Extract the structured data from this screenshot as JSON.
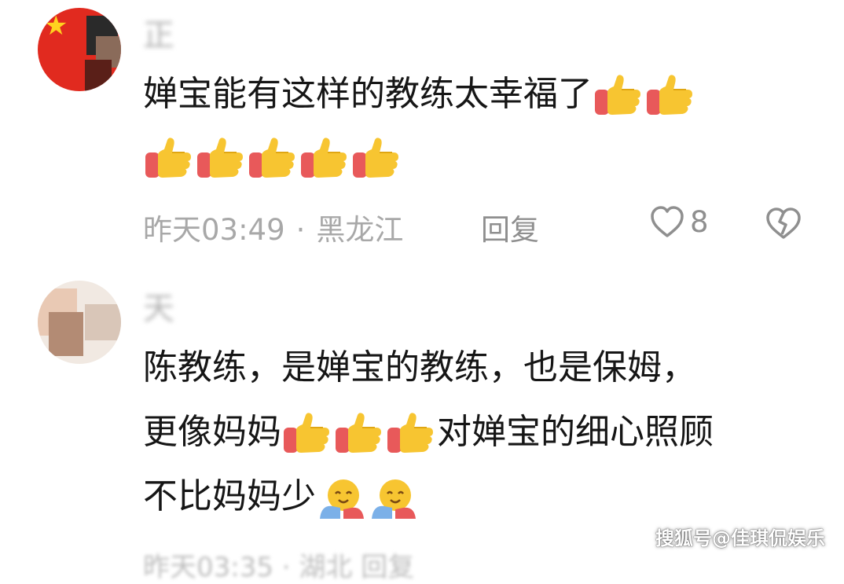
{
  "comments": [
    {
      "username": "正",
      "lines": [
        "婵宝能有这样的教练太幸福了",
        ""
      ],
      "time": "昨天03:49",
      "location": "黑龙江",
      "reply": "回复",
      "likes": "8"
    },
    {
      "username": "天",
      "lines": [
        "陈教练，是婵宝的教练，也是保姆，",
        "更像妈妈",
        "对婵宝的细心照顾",
        "不比妈妈少"
      ],
      "footer_partial": "昨天03:35 · 湖北   回复"
    }
  ],
  "icons": {
    "thumb": "thumbs-up-emoji",
    "hug": "hugging-face-emoji",
    "heart": "heart-outline-icon",
    "broken_heart": "broken-heart-icon",
    "flag": "china-flag-star"
  },
  "watermark": "搜狐号@佳琪侃娱乐",
  "colors": {
    "meta": "#a8a8a8",
    "text": "#161616",
    "thumb": "#f7c531",
    "sleeve": "#e8595a"
  }
}
